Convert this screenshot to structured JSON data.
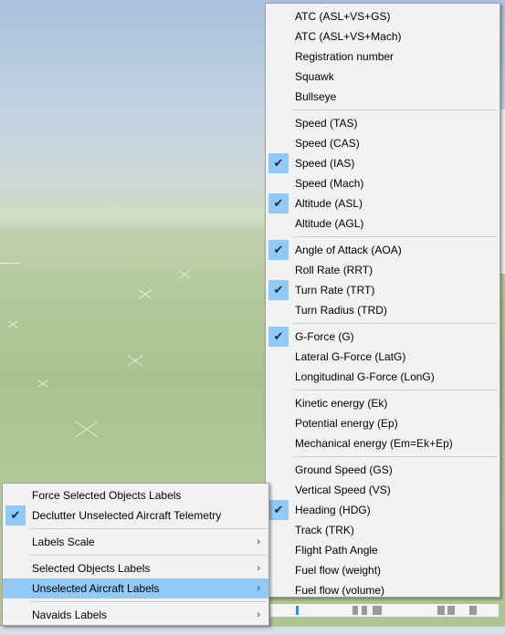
{
  "left_menu": {
    "items": [
      {
        "label": "Force Selected Objects Labels",
        "checked": false,
        "submenu": false,
        "highlighted": false
      },
      {
        "label": "Declutter Unselected Aircraft Telemetry",
        "checked": true,
        "submenu": false,
        "highlighted": false
      },
      {
        "separator": true
      },
      {
        "label": "Labels Scale",
        "checked": false,
        "submenu": true,
        "highlighted": false
      },
      {
        "separator": true
      },
      {
        "label": "Selected Objects Labels",
        "checked": false,
        "submenu": true,
        "highlighted": false
      },
      {
        "label": "Unselected Aircraft Labels",
        "checked": false,
        "submenu": true,
        "highlighted": true
      },
      {
        "separator": true
      },
      {
        "label": "Navaids Labels",
        "checked": false,
        "submenu": true,
        "highlighted": false
      }
    ]
  },
  "right_menu": {
    "items": [
      {
        "label": "ATC (ASL+VS+GS)",
        "checked": false
      },
      {
        "label": "ATC (ASL+VS+Mach)",
        "checked": false
      },
      {
        "label": "Registration number",
        "checked": false
      },
      {
        "label": "Squawk",
        "checked": false
      },
      {
        "label": "Bullseye",
        "checked": false
      },
      {
        "separator": true
      },
      {
        "label": "Speed (TAS)",
        "checked": false
      },
      {
        "label": "Speed (CAS)",
        "checked": false
      },
      {
        "label": "Speed (IAS)",
        "checked": true
      },
      {
        "label": "Speed (Mach)",
        "checked": false
      },
      {
        "label": "Altitude (ASL)",
        "checked": true
      },
      {
        "label": "Altitude (AGL)",
        "checked": false
      },
      {
        "separator": true
      },
      {
        "label": "Angle of Attack (AOA)",
        "checked": true
      },
      {
        "label": "Roll Rate (RRT)",
        "checked": false
      },
      {
        "label": "Turn Rate (TRT)",
        "checked": true
      },
      {
        "label": "Turn Radius (TRD)",
        "checked": false
      },
      {
        "separator": true
      },
      {
        "label": "G-Force (G)",
        "checked": true
      },
      {
        "label": "Lateral G-Force (LatG)",
        "checked": false
      },
      {
        "label": "Longitudinal G-Force (LonG)",
        "checked": false
      },
      {
        "separator": true
      },
      {
        "label": "Kinetic energy (Ek)",
        "checked": false
      },
      {
        "label": "Potential energy (Ep)",
        "checked": false
      },
      {
        "label": "Mechanical energy (Em=Ek+Ep)",
        "checked": false
      },
      {
        "separator": true
      },
      {
        "label": "Ground Speed (GS)",
        "checked": false
      },
      {
        "label": "Vertical Speed (VS)",
        "checked": false
      },
      {
        "label": "Heading (HDG)",
        "checked": true
      },
      {
        "label": "Track (TRK)",
        "checked": false
      },
      {
        "label": "Flight Path Angle",
        "checked": false
      },
      {
        "label": "Fuel flow (weight)",
        "checked": false
      },
      {
        "label": "Fuel flow (volume)",
        "checked": false
      }
    ]
  },
  "icons": {
    "check": "✔",
    "submenu_arrow": "›"
  },
  "colors": {
    "highlight": "#91c9f7",
    "menu_bg": "#f2f2f2",
    "menu_border": "#a0a0a0"
  }
}
